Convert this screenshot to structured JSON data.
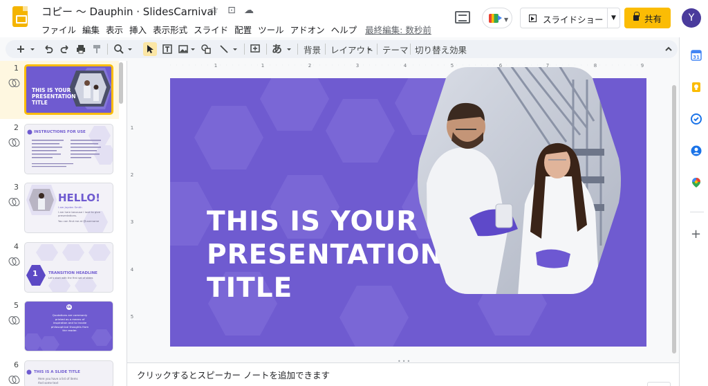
{
  "app": {
    "doc_title": "コピー 〜 Dauphin · SlidesCarnival",
    "menu": [
      "ファイル",
      "編集",
      "表示",
      "挿入",
      "表示形式",
      "スライド",
      "配置",
      "ツール",
      "アドオン",
      "ヘルプ"
    ],
    "last_edit": "最終編集: 数秒前"
  },
  "header": {
    "slideshow_label": "スライドショー",
    "share_label": "共有",
    "avatar_initial": "Y"
  },
  "toolbar": {
    "background_label": "背景",
    "layout_label": "レイアウト",
    "theme_label": "テーマ",
    "transition_label": "切り替え効果",
    "text_style_glyph": "あ"
  },
  "ruler": {
    "h_labels": [
      "1",
      "1",
      "2",
      "3",
      "4",
      "5",
      "6",
      "7",
      "8",
      "9"
    ],
    "v_labels": [
      "1",
      "2",
      "3",
      "4",
      "5"
    ]
  },
  "slides": [
    {
      "num": "1",
      "title": "THIS IS YOUR PRESENTATION TITLE"
    },
    {
      "num": "2",
      "title": "INSTRUCTIONS FOR USE"
    },
    {
      "num": "3",
      "title": "HELLO!",
      "subtitle": "I am Jayden Smith",
      "lines": [
        "I am here because I love to give presentations.",
        "You can find me at @username"
      ]
    },
    {
      "num": "4",
      "badge": "1",
      "title": "TRANSITION HEADLINE",
      "subtitle": "Let's start with the first set of slides"
    },
    {
      "num": "5",
      "badge": "66",
      "quote": "Quotations are commonly printed as a means of inspiration and to invoke philosophical thoughts from the reader."
    },
    {
      "num": "6",
      "title": "THIS IS A SLIDE TITLE",
      "lines": [
        "Here you have a list of items",
        "And some text"
      ]
    }
  ],
  "main_slide": {
    "title_lines": [
      "THIS IS YOUR",
      "PRESENTATION",
      "TITLE"
    ]
  },
  "notes": {
    "placeholder": "クリックするとスピーカー ノートを追加できます"
  },
  "colors": {
    "accent": "#fbbc04",
    "slide_purple": "#6f5bd0",
    "avatar": "#4a3b9c"
  }
}
